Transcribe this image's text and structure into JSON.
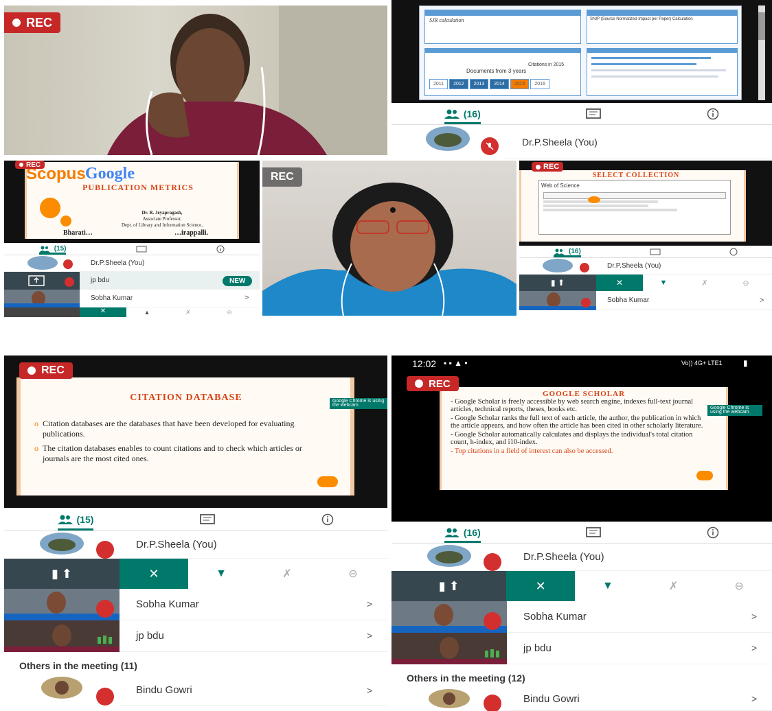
{
  "rec_label": "REC",
  "colors": {
    "accent": "#00796b",
    "rec_red": "#c62828",
    "mic_off": "#d32f2f",
    "slide_orange": "#d84315"
  },
  "panel_top_right": {
    "tab_people": "(16)",
    "participants": [
      {
        "name": "Dr.P.Sheela (You)"
      }
    ],
    "slide_left_box_title": "SJR calculation",
    "slide_right_box_title": "SNIP (Source Normalized Impact per Paper) Calculation",
    "years": [
      "2011",
      "2012",
      "2013",
      "2014",
      "2015",
      "2016"
    ],
    "documents_label": "Documents from 3 years",
    "citations_label": "Citations in 2015"
  },
  "panel_mid_left": {
    "slide_logo": "Scopus",
    "slide_logo2": "Google",
    "slide_title": "PUBLICATION METRICS",
    "presenter": "Dr. R. Jeyapragash,",
    "presenter_role": "Associate Professor,",
    "presenter_dept": "Dept. of Library and Information Science,",
    "presenter_inst": "Bharati…",
    "presenter_city": "…irappalli.",
    "tab_people": "(15)",
    "participants": [
      {
        "name": "Dr.P.Sheela (You)"
      },
      {
        "name": "jp bdu",
        "badge": "NEW"
      },
      {
        "name": "Sobha Kumar"
      }
    ]
  },
  "panel_mid_right": {
    "slide_title": "SELECT COLLECTION",
    "slide_sub": "Web of Science",
    "tab_people": "(16)",
    "participants": [
      {
        "name": "Dr.P.Sheela (You)"
      },
      {
        "name": "Sobha Kumar"
      }
    ]
  },
  "panel_bottom_left": {
    "slide_title": "CITATION DATABASE",
    "bullets": [
      "Citation databases are the databases that have been developed for evaluating publications.",
      "The citation databases enables to count citations and to check which articles or journals are the most cited ones."
    ],
    "chrome_notice": "Google Chrome is using the webcam",
    "tab_people": "(15)",
    "participants": [
      {
        "name": "Dr.P.Sheela (You)"
      },
      {
        "name": "Sobha Kumar"
      },
      {
        "name": "jp bdu"
      }
    ],
    "others_heading": "Others in the meeting (11)",
    "others": [
      {
        "name": "Bindu Gowri"
      }
    ]
  },
  "panel_bottom_right": {
    "status_time": "12:02",
    "status_net": "Vo)) 4G+ LTE1",
    "slide_title": "GOOGLE SCHOLAR",
    "chrome_notice": "Google Chrome is using the webcam",
    "bullets": [
      "- Google Scholar is freely accessible by web search engine, indexes full-text journal articles, technical reports, theses, books etc.",
      "- Google Scholar ranks the full text of each article, the author, the publication in which the article appears, and how often the article has been cited in other scholarly literature.",
      "- Google Scholar automatically calculates and displays the individual's total citation count, h-index, and i10-index.",
      "- Top citations in a field of interest can also be accessed."
    ],
    "tab_people": "(16)",
    "participants": [
      {
        "name": "Dr.P.Sheela (You)"
      },
      {
        "name": "Sobha Kumar"
      },
      {
        "name": "jp bdu"
      }
    ],
    "others_heading": "Others in the meeting (12)",
    "others": [
      {
        "name": "Bindu Gowri"
      }
    ]
  }
}
